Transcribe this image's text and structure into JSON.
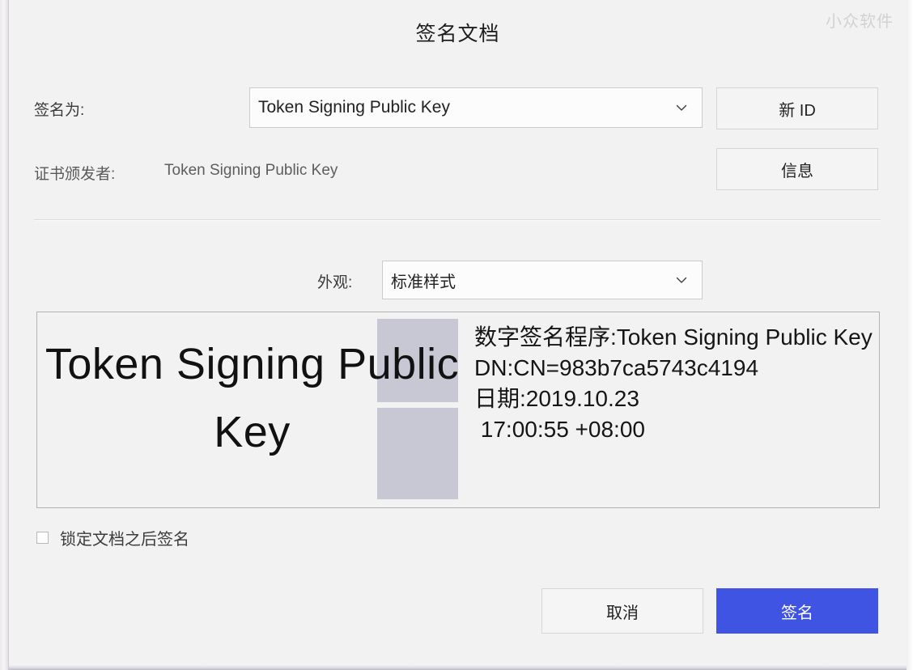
{
  "window": {
    "title": "签名文档",
    "watermark": "小众软件"
  },
  "form": {
    "sign_as_label": "签名为:",
    "sign_as_value": "Token Signing Public Key",
    "new_id_button": "新 ID",
    "issuer_label": "证书颁发者:",
    "issuer_value": "Token Signing Public Key",
    "info_button": "信息",
    "appearance_label": "外观:",
    "appearance_value": "标准样式"
  },
  "preview": {
    "big_text": "Token Signing Public Key",
    "details": "数字签名程序:Token Signing Public Key\nDN:CN=983b7ca5743c4194\n日期:2019.10.23\n 17:00:55 +08:00"
  },
  "options": {
    "lock_after_sign_label": "锁定文档之后签名",
    "lock_after_sign_checked": false
  },
  "footer": {
    "cancel_button": "取消",
    "sign_button": "签名"
  },
  "colors": {
    "primary": "#4054e4",
    "dialog_background": "#f2f2f2",
    "redaction": "#c8c8d4",
    "border": "#cccccc"
  }
}
